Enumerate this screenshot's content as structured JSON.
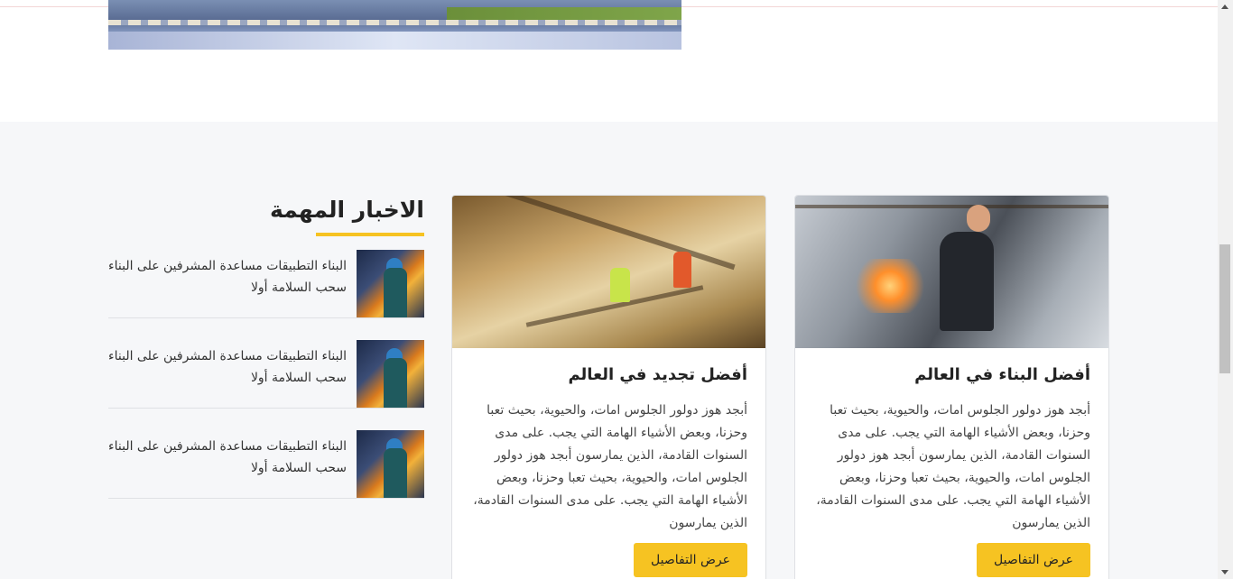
{
  "news": {
    "title": "الاخبار المهمة",
    "items": [
      {
        "text": "البناء التطبيقات مساعدة المشرفين على البناء سحب السلامة أولا"
      },
      {
        "text": "البناء التطبيقات مساعدة المشرفين على البناء سحب السلامة أولا"
      },
      {
        "text": "البناء التطبيقات مساعدة المشرفين على البناء سحب السلامة أولا"
      }
    ]
  },
  "cards": [
    {
      "title": "أفضل البناء في العالم",
      "description": "أبجد هوز دولور الجلوس امات، والحيوية، بحيث تعبا وحزنا، وبعض الأشياء الهامة التي يجب. على مدى السنوات القادمة، الذين يمارسون أبجد هوز دولور الجلوس امات، والحيوية، بحيث تعبا وحزنا، وبعض الأشياء الهامة التي يجب. على مدى السنوات القادمة، الذين يمارسون",
      "button": "عرض التفاصيل"
    },
    {
      "title": "أفضل تجديد في العالم",
      "description": "أبجد هوز دولور الجلوس امات، والحيوية، بحيث تعبا وحزنا، وبعض الأشياء الهامة التي يجب. على مدى السنوات القادمة، الذين يمارسون أبجد هوز دولور الجلوس امات، والحيوية، بحيث تعبا وحزنا، وبعض الأشياء الهامة التي يجب. على مدى السنوات القادمة، الذين يمارسون",
      "button": "عرض التفاصيل"
    }
  ],
  "colors": {
    "accent": "#f6c322",
    "section_bg": "#f6f7f9"
  }
}
